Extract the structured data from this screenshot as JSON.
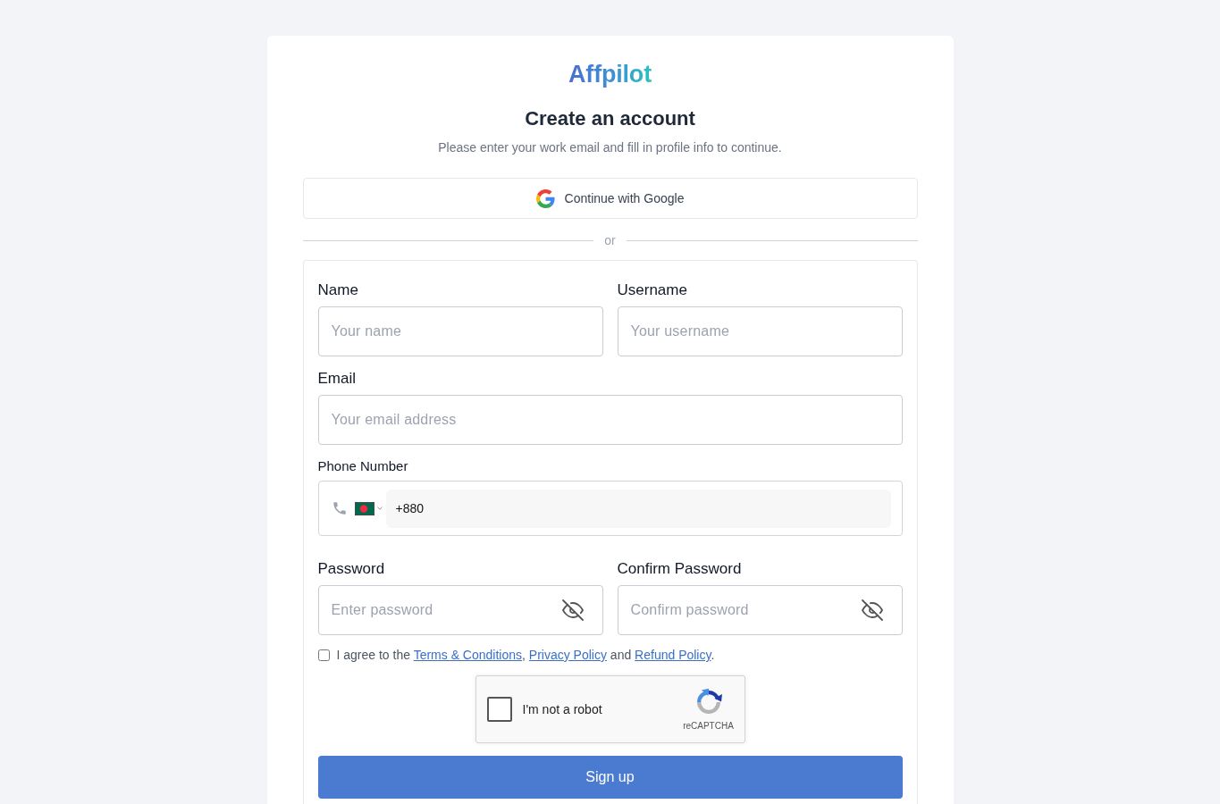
{
  "logo": {
    "text": "Affpilot"
  },
  "header": {
    "title": "Create an account",
    "subtitle": "Please enter your work email and fill in profile info to continue."
  },
  "google_button": {
    "label": "Continue with Google"
  },
  "divider": {
    "label": "or"
  },
  "form": {
    "rows": [
      {
        "fields": [
          {
            "kind": "text",
            "label": "Name",
            "placeholder": "Your name"
          },
          {
            "kind": "text",
            "label": "Username",
            "placeholder": "Your username"
          }
        ]
      },
      {
        "fields": [
          {
            "kind": "text",
            "label": "Email",
            "placeholder": "Your email address"
          }
        ]
      },
      {
        "fields": [
          {
            "kind": "phone",
            "label": "Phone Number",
            "value": "+880"
          }
        ]
      },
      {
        "fields": [
          {
            "kind": "password",
            "label": "Password",
            "placeholder": "Enter password"
          },
          {
            "kind": "password",
            "label": "Confirm Password",
            "placeholder": "Confirm password"
          }
        ]
      }
    ],
    "agreement": {
      "checked": false,
      "parts": [
        {
          "kind": "text",
          "text": "I agree to the "
        },
        {
          "kind": "link",
          "text": "Terms & Conditions"
        },
        {
          "kind": "text",
          "text": ", "
        },
        {
          "kind": "link",
          "text": "Privacy Policy"
        },
        {
          "kind": "text",
          "text": " and "
        },
        {
          "kind": "link",
          "text": "Refund Policy"
        },
        {
          "kind": "text",
          "text": "."
        }
      ]
    },
    "captcha": {
      "checked": false,
      "label": "I'm not a robot",
      "brand": "reCAPTCHA"
    },
    "submit": {
      "label": "Sign up"
    }
  }
}
